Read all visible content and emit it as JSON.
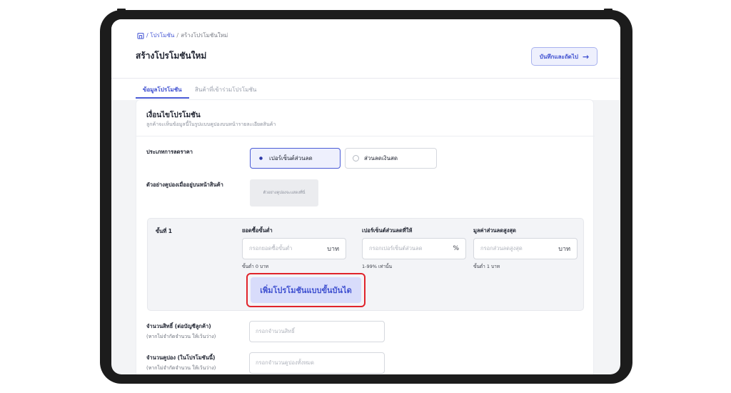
{
  "breadcrumb": {
    "root": "/ โปรโมชัน",
    "separator": "/",
    "current": "สร้างโปรโมชันใหม่"
  },
  "header": {
    "title": "สร้างโปรโมชันใหม่",
    "save_label": "บันทึกและถัดไป",
    "save_arrow": "→"
  },
  "tabs": [
    {
      "label": "ข้อมูลโปรโมชัน",
      "active": true
    },
    {
      "label": "สินค้าที่เข้าร่วมโปรโมชัน",
      "active": false
    }
  ],
  "section": {
    "title": "เงื่อนไขโปรโมชัน",
    "subtitle": "ลูกค้าจะเห็นข้อมูลนี้ในรูปแบบคูปองบนหน้ารายละเอียดสินค้า"
  },
  "discount_type": {
    "label": "ประเภทการลดราคา",
    "options": [
      {
        "label": "เปอร์เซ็นต์ส่วนลด",
        "selected": true
      },
      {
        "label": "ส่วนลดเงินสด",
        "selected": false
      }
    ]
  },
  "coupon_preview": {
    "label": "ตัวอย่างคูปองเมื่ออยู่บนหน้าสินค้า",
    "placeholder": "ตัวอย่างคูปองจะแสดงที่นี่"
  },
  "tier": {
    "label": "ขั้นที่ 1",
    "min_purchase": {
      "label": "ยอดซื้อขั้นต่ำ",
      "placeholder": "กรอกยอดซื้อขั้นต่ำ",
      "unit": "บาท",
      "hint": "ขั้นต่ำ 0 บาท"
    },
    "percent": {
      "label": "เปอร์เซ็นต์ส่วนลดที่ให้",
      "placeholder": "กรอกเปอร์เซ็นต์ส่วนลด",
      "unit": "%",
      "hint": "1-99% เท่านั้น"
    },
    "max_discount": {
      "label": "มูลค่าส่วนลดสูงสุด",
      "placeholder": "กรอกส่วนลดสูงสุด",
      "unit": "บาท",
      "hint": "ขั้นต่ำ 1 บาท"
    },
    "add_ladder_label": "เพิ่มโปรโมชันแบบขั้นบันได"
  },
  "rights": {
    "label": "จำนวนสิทธิ์ (ต่อบัญชีลูกค้า)",
    "sublabel": "(หากไม่จำกัดจำนวน ให้เว้นว่าง)",
    "placeholder": "กรอกจำนวนสิทธิ์"
  },
  "coupons": {
    "label": "จำนวนคูปอง (ในโปรโมชันนี้)",
    "sublabel": "(หากไม่จำกัดจำนวน ให้เว้นว่าง)",
    "placeholder": "กรอกจำนวนคูปองทั้งหมด"
  },
  "colors": {
    "accent": "#4a5bd6",
    "highlight": "#e0242b"
  }
}
